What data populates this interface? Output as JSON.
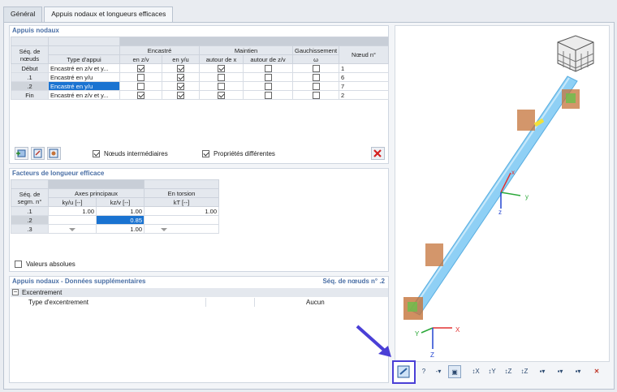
{
  "tabs": [
    {
      "label": "Général"
    },
    {
      "label": "Appuis nodaux et longueurs efficaces"
    }
  ],
  "nodal": {
    "title": "Appuis nodaux",
    "h_seq": "Séq. de nœuds",
    "h_type": "Type d'appui",
    "h_encastre": "Encastré",
    "h_maintien": "Maintien",
    "h_gauch": "Gauchissement",
    "h_noeud": "Nœud n°",
    "h_enzv": "en z/v",
    "h_enyu": "en y/u",
    "h_autourx": "autour de x",
    "h_autourzv": "autour de z/v",
    "h_omega": "ω",
    "rows": [
      {
        "seq": "Début",
        "type": "Encastré en z/v et y...",
        "zv": true,
        "yu": true,
        "ax": true,
        "azv": false,
        "w": false,
        "node": "1"
      },
      {
        "seq": ".1",
        "type": "Encastré en y/u",
        "zv": false,
        "yu": true,
        "ax": false,
        "azv": false,
        "w": false,
        "node": "6"
      },
      {
        "seq": ".2",
        "type": "Encastré en y/u",
        "zv": false,
        "yu": true,
        "ax": false,
        "azv": false,
        "w": false,
        "node": "7"
      },
      {
        "seq": "Fin",
        "type": "Encastré en z/v et y...",
        "zv": true,
        "yu": true,
        "ax": true,
        "azv": false,
        "w": false,
        "node": "2"
      }
    ],
    "intermediate_label": "Nœuds intermédiaires",
    "intermediate_checked": true,
    "different_label": "Propriétés différentes",
    "different_checked": true
  },
  "lengths": {
    "title": "Facteurs de longueur efficace",
    "h_seq": "Séq. de segm. n°",
    "h_axes": "Axes principaux",
    "h_torsion": "En torsion",
    "h_ky": "ky/u [--]",
    "h_kz": "kz/v [--]",
    "h_kt": "kT [--]",
    "rows": [
      {
        "seq": ".1",
        "ky": "1.00",
        "kz": "1.00",
        "kt": "1.00"
      },
      {
        "seq": ".2",
        "ky": "",
        "kz": "0.85",
        "kt": ""
      },
      {
        "seq": ".3",
        "ky": "",
        "kz": "1.00",
        "kt": ""
      }
    ],
    "absolute_label": "Valeurs absolues",
    "absolute_checked": false
  },
  "extra": {
    "title": "Appuis nodaux - Données supplémentaires",
    "seq_label": "Séq. de nœuds n° .2",
    "group_label": "Excentrement",
    "prop_label": "Type d'excentrement",
    "prop_value": "Aucun"
  },
  "axes": {
    "x": "x",
    "y": "y",
    "z": "z",
    "x2": "X",
    "y2": "Y",
    "z2": "Z"
  },
  "colors": {
    "member": "#8fd0f5",
    "support": "#c4733a",
    "highlight": "#4a3fd6",
    "accent": "#1a73d1"
  }
}
